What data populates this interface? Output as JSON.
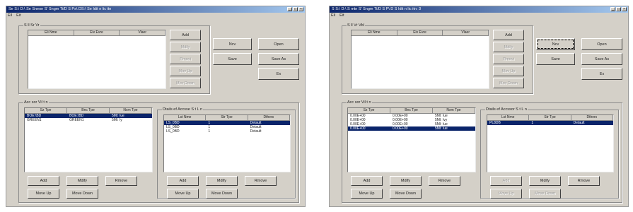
{
  "windows": [
    {
      "title": "Se S:\\ D:\\ Se Sneon S' Sngm Ti/D S Ps\\ DS:\\ Se Idit  n lic itn",
      "menu": [
        "Eil",
        "Eit"
      ],
      "file_group": {
        "label": "S  ll  Sr  Vr",
        "columns": [
          "Eli Nme",
          "Eiv Evre",
          "Vlaer"
        ],
        "rows": [],
        "buttons": [
          {
            "label": "Add",
            "disabled": false
          },
          {
            "label": "Mdily",
            "disabled": true
          },
          {
            "label": "Rmovi",
            "disabled": true
          },
          {
            "label": "Mov Up",
            "disabled": true
          },
          {
            "label": "Mov Down",
            "disabled": true
          }
        ]
      },
      "action_buttons": [
        {
          "label": "Ncv",
          "disabled": false,
          "focused": false
        },
        {
          "label": "Open",
          "disabled": false,
          "focused": false
        },
        {
          "label": "Save",
          "disabled": false,
          "focused": false
        },
        {
          "label": "Save As",
          "disabled": false,
          "focused": false
        },
        {
          "label": "Ex",
          "disabled": false,
          "focused": false
        }
      ],
      "acc_group": {
        "label": "Acc  sor Vil t  n",
        "columns": [
          "Sz Tpe",
          "Bnc Tpe",
          "Nxm Tpe"
        ],
        "rows": [
          {
            "cells": [
              "BOE:\\BD",
              "BOE:\\BD",
              "5Ml: Iue"
            ],
            "selected": true
          },
          {
            "cells": [
              "GREEN1",
              "GREEN1",
              "5Ml: Iy"
            ],
            "selected": false
          }
        ],
        "buttons": [
          {
            "label": "Add",
            "disabled": false
          },
          {
            "label": "Mdify",
            "disabled": false
          },
          {
            "label": "Rmove",
            "disabled": false
          },
          {
            "label": "Move Up",
            "disabled": false
          },
          {
            "label": "Move Down",
            "disabled": false
          }
        ]
      },
      "detail_group": {
        "label": "Dtails ef Accsse S t  L  n",
        "columns": [
          "Lst Nme",
          "Str Tpe",
          "Dthers"
        ],
        "rows": [
          {
            "cells": [
              "LS_0BD",
              "1",
              "Detault"
            ],
            "selected": true
          },
          {
            "cells": [
              "LS_0BD",
              "1",
              "Detault"
            ],
            "selected": false
          },
          {
            "cells": [
              "LS_0BD",
              "1",
              "Detault"
            ],
            "selected": false
          }
        ],
        "buttons": [
          {
            "label": "Add",
            "disabled": false
          },
          {
            "label": "Mdify",
            "disabled": false
          },
          {
            "label": "Rmove",
            "disabled": false
          },
          {
            "label": "Move Up",
            "disabled": false
          },
          {
            "label": "Move Down",
            "disabled": false
          }
        ]
      }
    },
    {
      "title": "S  S:\\ D:\\ S  mtn S' Sngm Ti/D S P\\ D S  Idit  n lic  itn: 3",
      "menu": [
        "Eil",
        "Eit"
      ],
      "file_group": {
        "label": "S  ll  Vr Vbl",
        "columns": [
          "Eli Nme",
          "Eiv Evre",
          "Vlaer"
        ],
        "rows": [],
        "buttons": [
          {
            "label": "Add",
            "disabled": false
          },
          {
            "label": "Mdily",
            "disabled": true
          },
          {
            "label": "Rmovi",
            "disabled": true
          },
          {
            "label": "Mov Up",
            "disabled": true
          },
          {
            "label": "Mov Down",
            "disabled": true
          }
        ]
      },
      "action_buttons": [
        {
          "label": "Ncv",
          "disabled": false,
          "focused": true
        },
        {
          "label": "Open",
          "disabled": false,
          "focused": false
        },
        {
          "label": "Save",
          "disabled": false,
          "focused": false
        },
        {
          "label": "Save As",
          "disabled": false,
          "focused": false
        },
        {
          "label": "Ex",
          "disabled": false,
          "focused": false
        }
      ],
      "acc_group": {
        "label": "Acc  sor Vil t  n",
        "columns": [
          "Sz Tpe",
          "Bnc Tpe",
          "Nxm Tpe"
        ],
        "rows": [
          {
            "cells": [
              "0.00E+00",
              "0.00E+00",
              "5Ml: Iue"
            ],
            "selected": false
          },
          {
            "cells": [
              "0.00E+00",
              "0.00E+00",
              "5Ml: Ivy"
            ],
            "selected": false
          },
          {
            "cells": [
              "0.00E+00",
              "0.00E+00",
              "5Ml: Iue"
            ],
            "selected": false
          },
          {
            "cells": [
              "0.00E+00",
              "0.00E+00",
              "5Ml: Iue"
            ],
            "selected": true
          }
        ],
        "buttons": [
          {
            "label": "Add",
            "disabled": false
          },
          {
            "label": "Mdify",
            "disabled": false
          },
          {
            "label": "Rmove",
            "disabled": false
          },
          {
            "label": "Move Up",
            "disabled": false
          },
          {
            "label": "Move Down",
            "disabled": false
          }
        ]
      },
      "detail_group": {
        "label": "Dtails ef Accssor S t  L  n",
        "columns": [
          "Lst Nme",
          "Str Tpe",
          "Dthers"
        ],
        "rows": [
          {
            "cells": [
              "PL8DB",
              "1",
              "Detault"
            ],
            "selected": true
          }
        ],
        "buttons": [
          {
            "label": "Add",
            "disabled": true
          },
          {
            "label": "Mdify",
            "disabled": false
          },
          {
            "label": "Rmove",
            "disabled": false
          },
          {
            "label": "Move Up",
            "disabled": true
          },
          {
            "label": "Move Down",
            "disabled": true
          }
        ]
      }
    }
  ]
}
